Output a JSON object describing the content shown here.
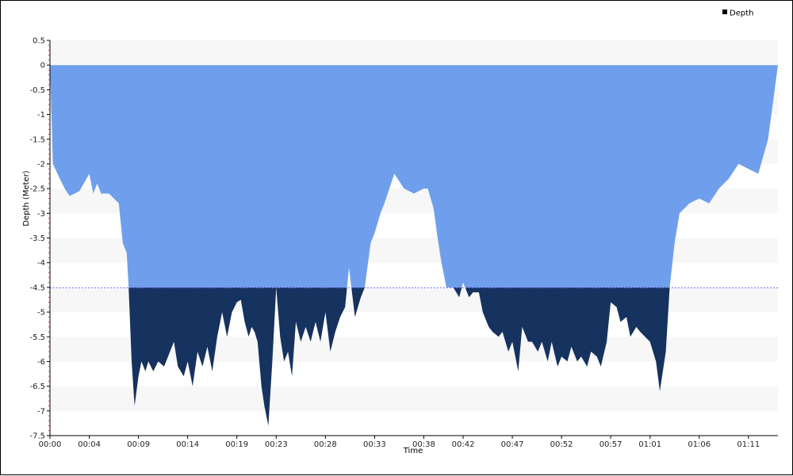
{
  "chart_data": {
    "type": "area",
    "xlabel": "Time",
    "ylabel": "Depth (Meter)",
    "legend": {
      "label": "Depth",
      "placement": "top-right"
    },
    "threshold": -4.5,
    "ylim": [
      -7.5,
      0.5
    ],
    "xlim_minutes": [
      0,
      74
    ],
    "y_ticks": [
      "0.5",
      "0",
      "-0.5",
      "-1",
      "-1.5",
      "-2",
      "-2.5",
      "-3",
      "-3.5",
      "-4",
      "-4.5",
      "-5",
      "-5.5",
      "-6",
      "-6.5",
      "-7",
      "-7.5"
    ],
    "x_ticks": [
      "00:00",
      "00:04",
      "00:09",
      "00:14",
      "00:19",
      "00:23",
      "00:28",
      "00:33",
      "00:38",
      "00:42",
      "00:47",
      "00:52",
      "00:57",
      "01:01",
      "01:06",
      "01:11"
    ],
    "colors": {
      "shallow": "#6f9fec",
      "deep": "#16325f",
      "threshold_line": "#6f6fff",
      "band": "#f7f7f7"
    },
    "series": [
      {
        "name": "Depth",
        "x": [
          "00:00",
          "00:00.3",
          "00:01",
          "00:01.5",
          "00:02",
          "00:03",
          "00:04",
          "00:04.4",
          "00:04.8",
          "00:05.2",
          "00:06",
          "00:07",
          "00:07.4",
          "00:07.8",
          "00:08",
          "00:08.3",
          "00:08.6",
          "00:09",
          "00:09.3",
          "00:09.7",
          "00:10",
          "00:10.5",
          "00:11",
          "00:11.6",
          "00:12",
          "00:12.6",
          "00:13",
          "00:13.6",
          "00:14",
          "00:14.5",
          "00:15",
          "00:15.5",
          "00:16",
          "00:16.5",
          "00:17",
          "00:17.5",
          "00:18",
          "00:18.5",
          "00:19",
          "00:19.4",
          "00:19.8",
          "00:20.2",
          "00:20.5",
          "00:20.8",
          "00:21.1",
          "00:21.5",
          "00:21.8",
          "00:22.2",
          "00:22.6",
          "00:23",
          "00:23.4",
          "00:23.8",
          "00:24.2",
          "00:24.6",
          "00:25",
          "00:25.5",
          "00:26",
          "00:26.5",
          "00:27",
          "00:27.5",
          "00:28",
          "00:28.5",
          "00:29",
          "00:29.5",
          "00:30",
          "00:30.4",
          "00:31",
          "00:31.6",
          "00:32",
          "00:32.6",
          "00:33",
          "00:33.6",
          "00:34",
          "00:35",
          "00:36",
          "00:37",
          "00:38",
          "00:38.4",
          "00:39",
          "00:39.4",
          "00:39.8",
          "00:40.3",
          "00:41",
          "00:41.6",
          "00:42",
          "00:42.6",
          "00:43",
          "00:43.6",
          "00:44",
          "00:44.6",
          "00:45",
          "00:45.6",
          "00:46",
          "00:46.6",
          "00:47",
          "00:47.6",
          "00:48",
          "00:48.6",
          "00:49",
          "00:49.6",
          "00:50",
          "00:50.6",
          "00:51",
          "00:51.6",
          "00:52",
          "00:52.6",
          "00:53",
          "00:53.6",
          "00:54",
          "00:54.6",
          "00:55",
          "00:55.6",
          "00:56",
          "00:56.6",
          "00:57",
          "00:57.6",
          "00:58",
          "00:58.6",
          "00:59",
          "00:59.6",
          "01:00",
          "01:00.5",
          "01:01",
          "01:01.6",
          "01:02",
          "01:02.6",
          "01:03",
          "01:03.5",
          "01:04",
          "01:05",
          "01:06",
          "01:07",
          "01:08",
          "01:09",
          "01:10",
          "01:11",
          "01:12",
          "01:13",
          "01:14"
        ],
        "minutes": [
          0.0,
          0.3,
          1.0,
          1.5,
          2.0,
          3.0,
          4.0,
          4.4,
          4.8,
          5.2,
          6.0,
          7.0,
          7.4,
          7.8,
          8.0,
          8.3,
          8.6,
          9.0,
          9.3,
          9.7,
          10.0,
          10.5,
          11.0,
          11.6,
          12.0,
          12.6,
          13.0,
          13.6,
          14.0,
          14.5,
          15.0,
          15.5,
          16.0,
          16.5,
          17.0,
          17.5,
          18.0,
          18.5,
          19.0,
          19.4,
          19.8,
          20.2,
          20.5,
          20.8,
          21.1,
          21.5,
          21.8,
          22.2,
          22.6,
          23.0,
          23.4,
          23.8,
          24.2,
          24.6,
          25.0,
          25.5,
          26.0,
          26.5,
          27.0,
          27.5,
          28.0,
          28.5,
          29.0,
          29.5,
          30.0,
          30.4,
          31.0,
          31.6,
          32.0,
          32.6,
          33.0,
          33.6,
          34.0,
          35.0,
          36.0,
          37.0,
          38.0,
          38.4,
          39.0,
          39.4,
          39.8,
          40.3,
          41.0,
          41.6,
          42.0,
          42.6,
          43.0,
          43.6,
          44.0,
          44.6,
          45.0,
          45.6,
          46.0,
          46.6,
          47.0,
          47.6,
          48.0,
          48.6,
          49.0,
          49.6,
          50.0,
          50.6,
          51.0,
          51.6,
          52.0,
          52.6,
          53.0,
          53.6,
          54.0,
          54.6,
          55.0,
          55.6,
          56.0,
          56.6,
          57.0,
          57.6,
          58.0,
          58.6,
          59.0,
          59.6,
          60.0,
          60.5,
          61.0,
          61.6,
          62.0,
          62.6,
          63.0,
          63.5,
          64.0,
          65.0,
          66.0,
          67.0,
          68.0,
          69.0,
          70.0,
          71.0,
          72.0,
          73.0,
          74.0
        ],
        "values": [
          0.0,
          -2.0,
          -2.3,
          -2.5,
          -2.65,
          -2.55,
          -2.2,
          -2.6,
          -2.4,
          -2.6,
          -2.6,
          -2.8,
          -3.6,
          -3.8,
          -4.5,
          -6.0,
          -6.9,
          -6.3,
          -6.0,
          -6.2,
          -6.0,
          -6.2,
          -6.0,
          -6.1,
          -5.9,
          -5.6,
          -6.1,
          -6.3,
          -6.0,
          -6.5,
          -5.8,
          -6.1,
          -5.7,
          -6.2,
          -5.5,
          -5.0,
          -5.5,
          -5.0,
          -4.8,
          -4.75,
          -5.2,
          -5.5,
          -5.3,
          -5.4,
          -5.6,
          -6.5,
          -6.9,
          -7.3,
          -6.0,
          -4.5,
          -5.5,
          -6.0,
          -5.8,
          -6.3,
          -5.2,
          -5.6,
          -5.3,
          -5.6,
          -5.2,
          -5.6,
          -5.0,
          -5.8,
          -5.4,
          -5.1,
          -4.9,
          -4.1,
          -5.1,
          -4.7,
          -4.5,
          -3.6,
          -3.4,
          -3.0,
          -2.8,
          -2.2,
          -2.5,
          -2.6,
          -2.5,
          -2.5,
          -2.9,
          -3.5,
          -4.0,
          -4.5,
          -4.5,
          -4.7,
          -4.4,
          -4.7,
          -4.6,
          -4.6,
          -5.0,
          -5.3,
          -5.4,
          -5.5,
          -5.4,
          -5.8,
          -5.6,
          -6.2,
          -5.3,
          -5.6,
          -5.6,
          -5.8,
          -5.6,
          -6.0,
          -5.6,
          -6.1,
          -5.9,
          -6.0,
          -5.7,
          -6.0,
          -5.9,
          -6.1,
          -5.8,
          -5.9,
          -6.1,
          -5.6,
          -4.8,
          -4.9,
          -5.2,
          -5.1,
          -5.5,
          -5.3,
          -5.4,
          -5.5,
          -5.6,
          -6.0,
          -6.6,
          -5.8,
          -4.5,
          -3.6,
          -3.0,
          -2.8,
          -2.7,
          -2.8,
          -2.5,
          -2.3,
          -2.0,
          -2.1,
          -2.2,
          -1.5,
          0.0
        ]
      }
    ]
  }
}
